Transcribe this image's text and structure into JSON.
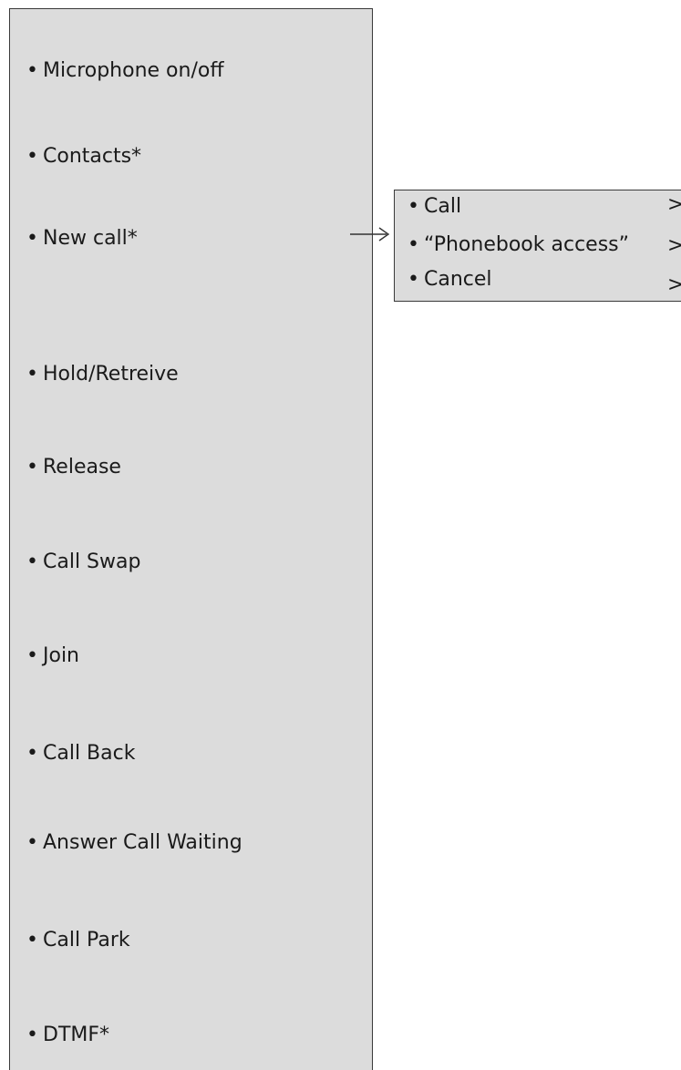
{
  "main_menu": {
    "items": [
      {
        "label": "Microphone on/off"
      },
      {
        "label": "Contacts*"
      },
      {
        "label": "New call*"
      },
      {
        "label": "Hold/Retreive"
      },
      {
        "label": "Release"
      },
      {
        "label": "Call Swap"
      },
      {
        "label": "Join"
      },
      {
        "label": "Call Back"
      },
      {
        "label": "Answer Call Waiting"
      },
      {
        "label": "Call Park"
      },
      {
        "label": "DTMF*"
      }
    ]
  },
  "submenu": {
    "items": [
      {
        "label": "Call"
      },
      {
        "label": "“Phonebook access”"
      },
      {
        "label": "Cancel"
      }
    ],
    "chevron": ">"
  },
  "bullet": "•"
}
